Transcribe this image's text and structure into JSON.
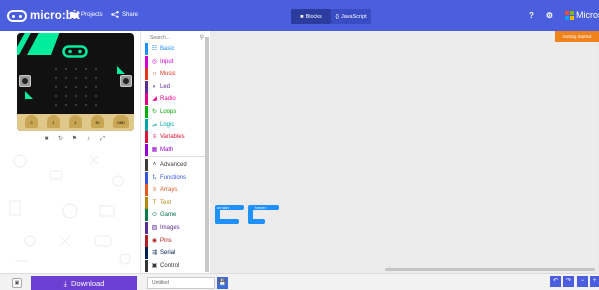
{
  "topbar": {
    "brand": "micro:bit",
    "projects_label": "Projects",
    "share_label": "Share",
    "tabs": [
      {
        "label": "Blocks",
        "active": true
      },
      {
        "label": "JavaScript",
        "active": false
      }
    ],
    "ms_label": "Microso"
  },
  "toolbox": {
    "search_placeholder": "Search...",
    "categories": [
      {
        "label": "Basic",
        "color": "#1e90ff",
        "icon": "grid-icon"
      },
      {
        "label": "Input",
        "color": "#d400d4",
        "icon": "target-icon"
      },
      {
        "label": "Music",
        "color": "#e63022",
        "icon": "headphones-icon"
      },
      {
        "label": "Led",
        "color": "#5c2d91",
        "icon": "toggle-icon"
      },
      {
        "label": "Radio",
        "color": "#e3008c",
        "icon": "signal-icon"
      },
      {
        "label": "Loops",
        "color": "#00aa00",
        "icon": "refresh-icon"
      },
      {
        "label": "Logic",
        "color": "#00a4a6",
        "icon": "shuffle-icon"
      },
      {
        "label": "Variables",
        "color": "#dc143c",
        "icon": "list-icon"
      },
      {
        "label": "Math",
        "color": "#9400d3",
        "icon": "calculator-icon"
      }
    ],
    "advanced": [
      {
        "label": "Advanced",
        "color": "#3c3c3c",
        "icon": "chevron-up-icon"
      },
      {
        "label": "Functions",
        "color": "#3455db",
        "icon": "function-icon"
      },
      {
        "label": "Arrays",
        "color": "#e65722",
        "icon": "list-icon"
      },
      {
        "label": "Text",
        "color": "#b8860b",
        "icon": "text-icon"
      },
      {
        "label": "Game",
        "color": "#007a4b",
        "icon": "gamepad-icon"
      },
      {
        "label": "Images",
        "color": "#5c2d91",
        "icon": "image-icon"
      },
      {
        "label": "Pins",
        "color": "#b22222",
        "icon": "pin-icon"
      },
      {
        "label": "Serial",
        "color": "#002050",
        "icon": "usb-icon"
      },
      {
        "label": "Control",
        "color": "#333333",
        "icon": "chip-icon"
      }
    ]
  },
  "workspace": {
    "getting_started": "Getting Started",
    "blocks": [
      {
        "label": "on start"
      },
      {
        "label": "forever"
      }
    ]
  },
  "bottom": {
    "download_label": "Download",
    "project_name_placeholder": "Untitled"
  }
}
